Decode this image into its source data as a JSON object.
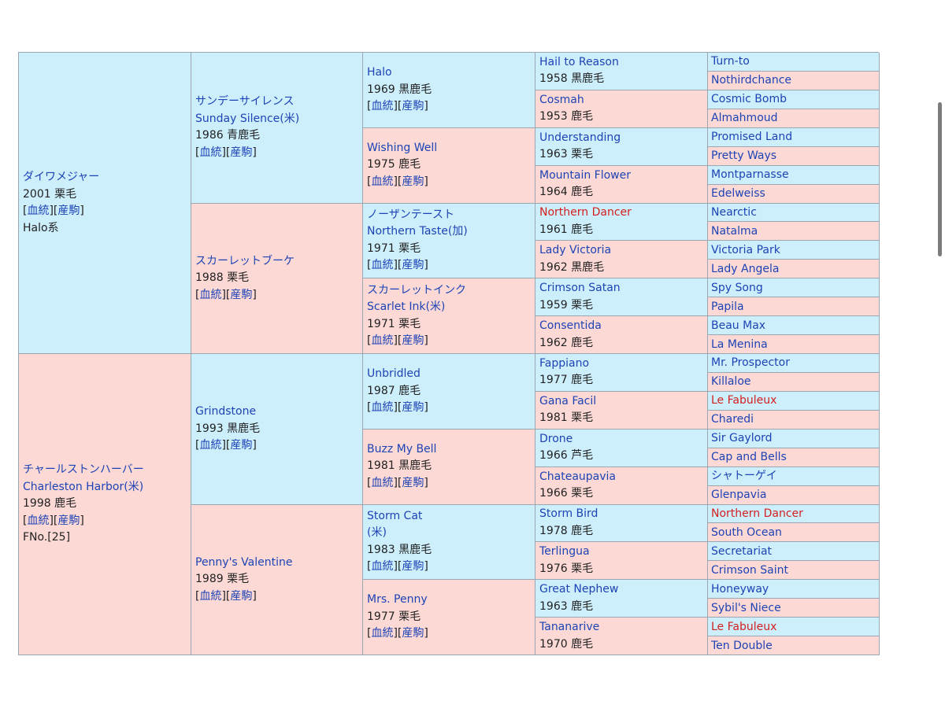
{
  "link_labels": {
    "bloodline": "血統",
    "progeny": "産駒"
  },
  "gen1": [
    {
      "name_ja": "ダイワメジャー",
      "year_color": "2001 栗毛",
      "extra": "Halo系"
    },
    {
      "name_ja": "チャールストンハーバー",
      "name_en": "Charleston Harbor(米)",
      "year_color": "1998 鹿毛",
      "extra": "FNo.[25]"
    }
  ],
  "gen2": [
    {
      "name_ja": "サンデーサイレンス",
      "name_en": "Sunday Silence(米)",
      "year_color": "1986 青鹿毛"
    },
    {
      "name": "スカーレットブーケ",
      "year_color": "1988 栗毛"
    },
    {
      "name": "Grindstone",
      "year_color": "1993 黒鹿毛"
    },
    {
      "name": "Penny's Valentine",
      "year_color": "1989 栗毛"
    }
  ],
  "gen3": [
    {
      "name": "Halo",
      "year_color": "1969 黒鹿毛"
    },
    {
      "name": "Wishing Well",
      "year_color": "1975 鹿毛"
    },
    {
      "name_ja": "ノーザンテースト",
      "name_en": "Northern Taste(加)",
      "year_color": "1971 栗毛"
    },
    {
      "name_ja": "スカーレットインク",
      "name_en": "Scarlet Ink(米)",
      "year_color": "1971 栗毛"
    },
    {
      "name": "Unbridled",
      "year_color": "1987 鹿毛"
    },
    {
      "name": "Buzz My Bell",
      "year_color": "1981 黒鹿毛"
    },
    {
      "name": "Storm Cat",
      "name_suffix": "(米)",
      "year_color": "1983 黒鹿毛"
    },
    {
      "name": "Mrs. Penny",
      "year_color": "1977 栗毛"
    }
  ],
  "gen4": [
    {
      "name": "Hail to Reason",
      "year_color": "1958 黒鹿毛"
    },
    {
      "name": "Cosmah",
      "year_color": "1953 鹿毛"
    },
    {
      "name": "Understanding",
      "year_color": "1963 栗毛"
    },
    {
      "name": "Mountain Flower",
      "year_color": "1964 鹿毛"
    },
    {
      "name": "Northern Dancer",
      "year_color": "1961 鹿毛"
    },
    {
      "name": "Lady Victoria",
      "year_color": "1962 黒鹿毛"
    },
    {
      "name": "Crimson Satan",
      "year_color": "1959 栗毛"
    },
    {
      "name": "Consentida",
      "year_color": "1962 鹿毛"
    },
    {
      "name": "Fappiano",
      "year_color": "1977 鹿毛"
    },
    {
      "name": "Gana Facil",
      "year_color": "1981 栗毛"
    },
    {
      "name": "Drone",
      "year_color": "1966 芦毛"
    },
    {
      "name": "Chateaupavia",
      "year_color": "1966 栗毛"
    },
    {
      "name": "Storm Bird",
      "year_color": "1978 鹿毛"
    },
    {
      "name": "Terlingua",
      "year_color": "1976 栗毛"
    },
    {
      "name": "Great Nephew",
      "year_color": "1963 鹿毛"
    },
    {
      "name": "Tananarive",
      "year_color": "1970 鹿毛"
    }
  ],
  "gen5": [
    "Turn-to",
    "Nothirdchance",
    "Cosmic Bomb",
    "Almahmoud",
    "Promised Land",
    "Pretty Ways",
    "Montparnasse",
    "Edelweiss",
    "Nearctic",
    "Natalma",
    "Victoria Park",
    "Lady Angela",
    "Spy Song",
    "Papila",
    "Beau Max",
    "La Menina",
    "Mr. Prospector",
    "Killaloe",
    "Le Fabuleux",
    "Charedi",
    "Sir Gaylord",
    "Cap and Bells",
    "シャトーゲイ",
    "Glenpavia",
    "Northern Dancer",
    "South Ocean",
    "Secretariat",
    "Crimson Saint",
    "Honeyway",
    "Sybil's Niece",
    "Le Fabuleux",
    "Ten Double"
  ],
  "colors": {
    "male_bg": "#cdeffc",
    "female_bg": "#fcd9d5",
    "link": "#1d43b5",
    "inbreeding_red": "#d32020",
    "border": "#9aa7b3"
  }
}
